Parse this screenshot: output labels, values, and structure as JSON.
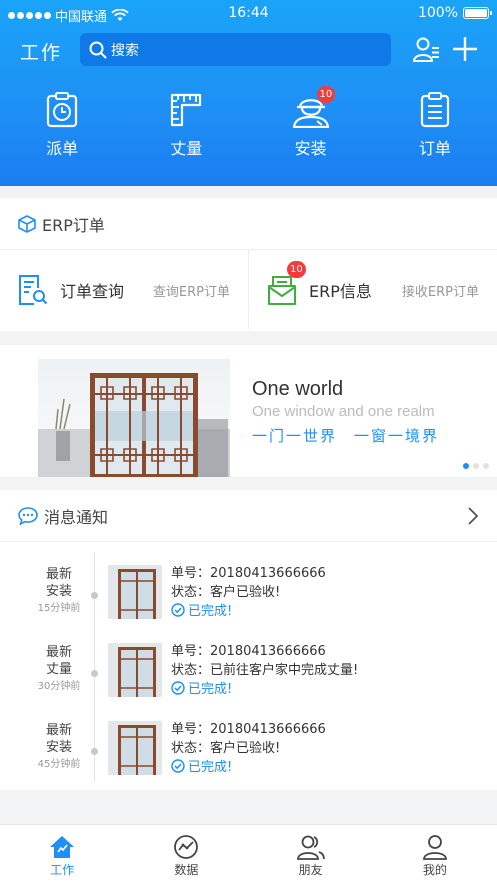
{
  "status_bar": {
    "carrier": "中国联通",
    "time": "16:44",
    "battery": "100%"
  },
  "header": {
    "title": "工作",
    "search_placeholder": "搜索"
  },
  "shortcuts": [
    {
      "label": "派单",
      "icon": "clock-clipboard-icon"
    },
    {
      "label": "丈量",
      "icon": "ruler-icon"
    },
    {
      "label": "安装",
      "icon": "installer-icon",
      "badge": "10"
    },
    {
      "label": "订单",
      "icon": "order-list-icon"
    }
  ],
  "erp": {
    "title": "ERP订单",
    "items": [
      {
        "name": "订单查询",
        "sub": "查询ERP订单"
      },
      {
        "name": "ERP信息",
        "sub": "接收ERP订单",
        "badge": "10"
      }
    ]
  },
  "banner": {
    "title": "One world",
    "subtitle": "One window and one realm",
    "slogan": "一门一世界　一窗一境界",
    "pages": 3,
    "active_page": 1
  },
  "messages": {
    "title": "消息通知",
    "items": [
      {
        "type_line1": "最新",
        "type_line2": "安装",
        "time": "15分钟前",
        "order_label": "单号：",
        "order_no": "20180413666666",
        "status_label": "状态：",
        "status": "客户已验收!",
        "done": "已完成!"
      },
      {
        "type_line1": "最新",
        "type_line2": "丈量",
        "time": "30分钟前",
        "order_label": "单号：",
        "order_no": "20180413666666",
        "status_label": "状态：",
        "status": "已前往客户家中完成丈量!",
        "done": "已完成!"
      },
      {
        "type_line1": "最新",
        "type_line2": "安装",
        "time": "45分钟前",
        "order_label": "单号：",
        "order_no": "20180413666666",
        "status_label": "状态：",
        "status": "客户已验收!",
        "done": "已完成!"
      }
    ]
  },
  "tabs": [
    {
      "label": "工作",
      "active": true
    },
    {
      "label": "数据"
    },
    {
      "label": "朋友"
    },
    {
      "label": "我的"
    }
  ],
  "colors": {
    "primary": "#1e8ff5",
    "badge": "#f23b3b",
    "erp_icon": "#1e8ff5",
    "erp_info_icon": "#3fae3f"
  }
}
